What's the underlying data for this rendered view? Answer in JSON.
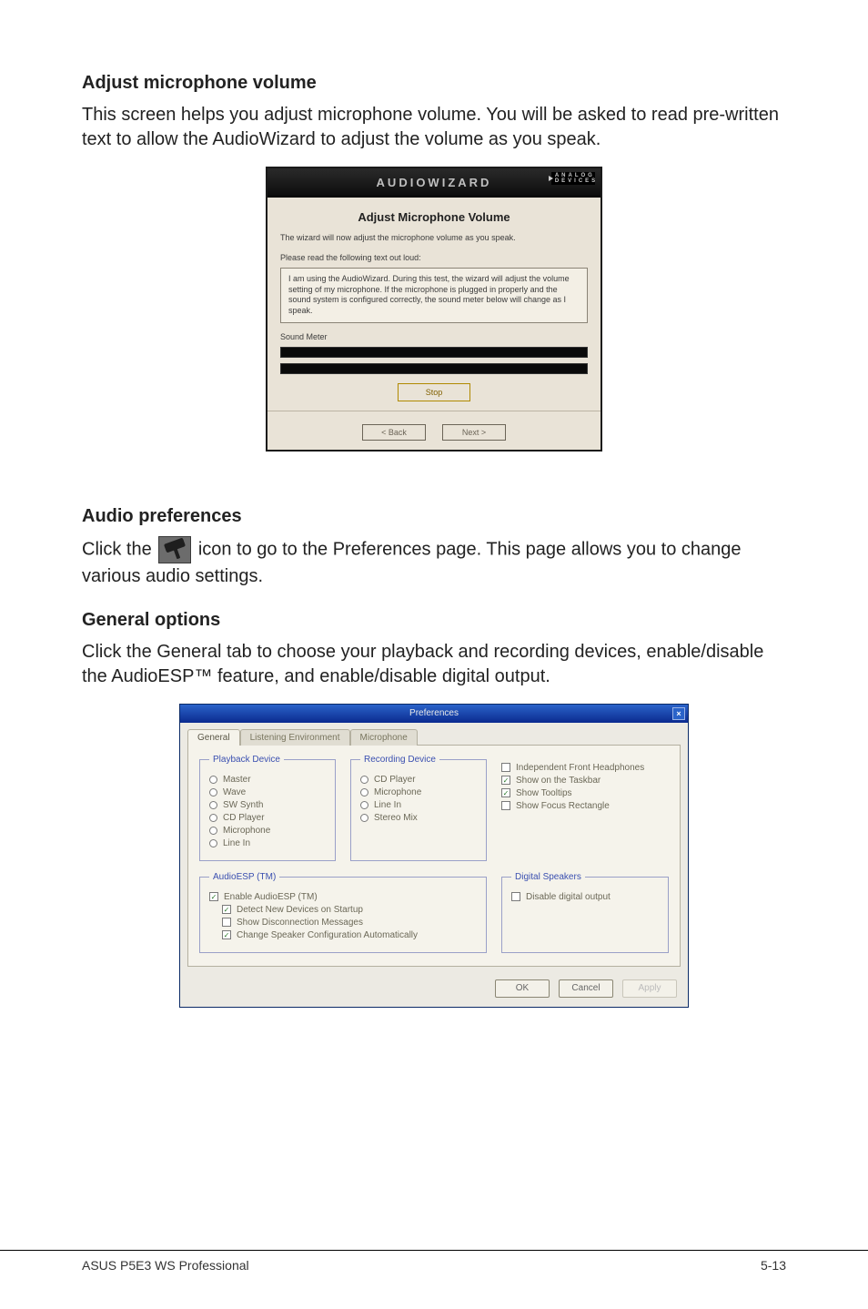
{
  "sections": {
    "adjust_title": "Adjust microphone volume",
    "adjust_body": "This screen helps you adjust microphone volume. You will be asked to read pre-written text to allow the AudioWizard to adjust the volume as you speak.",
    "audio_prefs_title": "Audio preferences",
    "audio_prefs_before": "Click the ",
    "audio_prefs_after": " icon to go to the Preferences page. This page allows you to change various audio settings.",
    "general_title": "General options",
    "general_body": "Click the General tab to choose your playback and recording devices, enable/disable the AudioESP™ feature, and enable/disable digital output."
  },
  "audiowizard": {
    "app_title": "AUDIOWIZARD",
    "logo_text": "ANALOG DEVICES",
    "header": "Adjust Microphone Volume",
    "desc": "The wizard will now adjust the microphone volume as you speak.",
    "instructions_label": "Please read the following text out loud:",
    "readout": "I am using the AudioWizard. During this test, the wizard will adjust the volume setting of my microphone. If the microphone is plugged in properly and the sound system is configured correctly, the sound meter below will change as I speak.",
    "meter_label": "Sound Meter",
    "stop_label": "Stop",
    "back_label": "< Back",
    "next_label": "Next >"
  },
  "prefs": {
    "title": "Preferences",
    "tabs": [
      "General",
      "Listening Environment",
      "Microphone"
    ],
    "playback_legend": "Playback Device",
    "playback_items": [
      "Master",
      "Wave",
      "SW Synth",
      "CD Player",
      "Microphone",
      "Line In"
    ],
    "recording_legend": "Recording Device",
    "recording_items": [
      "CD Player",
      "Microphone",
      "Line In",
      "Stereo Mix"
    ],
    "checks_right": [
      {
        "label": "Independent Front Headphones",
        "checked": false
      },
      {
        "label": "Show on the Taskbar",
        "checked": true
      },
      {
        "label": "Show Tooltips",
        "checked": true
      },
      {
        "label": "Show Focus Rectangle",
        "checked": false
      }
    ],
    "esp_legend": "AudioESP (TM)",
    "esp_items": [
      {
        "label": "Enable AudioESP (TM)",
        "checked": true
      },
      {
        "label": "Detect New Devices on Startup",
        "checked": true
      },
      {
        "label": "Show Disconnection Messages",
        "checked": false
      },
      {
        "label": "Change Speaker Configuration Automatically",
        "checked": true
      }
    ],
    "digital_legend": "Digital Speakers",
    "digital_items": [
      {
        "label": "Disable digital output",
        "checked": false
      }
    ],
    "buttons": {
      "ok": "OK",
      "cancel": "Cancel",
      "apply": "Apply"
    }
  },
  "footer": {
    "left": "ASUS P5E3 WS Professional",
    "right": "5-13"
  },
  "chart_data": {
    "type": "table",
    "note": "No chart present; document page with two embedded UI screenshots."
  }
}
